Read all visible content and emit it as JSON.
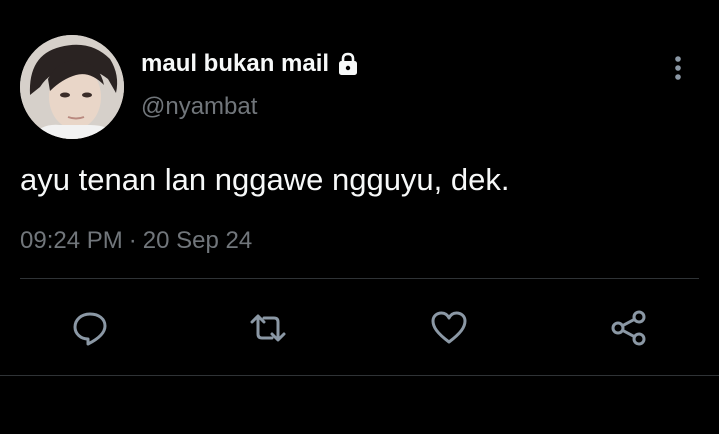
{
  "tweet": {
    "display_name": "maul bukan mail",
    "handle": "@nyambat",
    "text": "ayu tenan lan nggawe ngguyu, dek.",
    "time": "09:24 PM",
    "separator": "·",
    "date": "20 Sep 24"
  },
  "icons": {
    "account": "lock-icon",
    "menu": "more-vertical-icon",
    "actions": [
      "reply-icon",
      "retweet-icon",
      "like-icon",
      "share-icon"
    ]
  },
  "colors": {
    "background": "#000000",
    "primary_text": "#f7f9f9",
    "secondary_text": "#71767b",
    "divider": "#2f3336",
    "icon": "#8b98a5"
  }
}
